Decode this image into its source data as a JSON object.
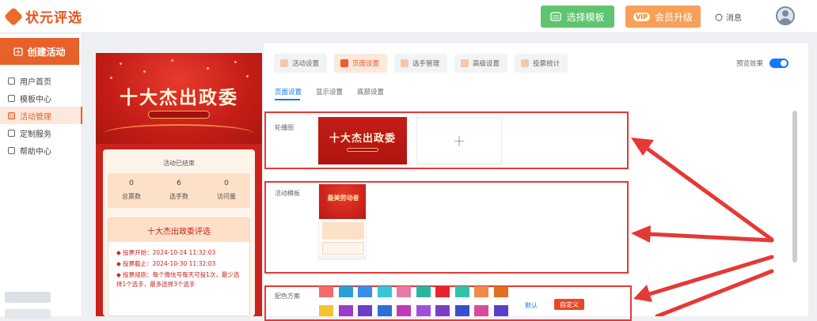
{
  "header": {
    "logo_text": "状元评选",
    "template_button": "选择模板",
    "vip_badge": "VIP",
    "vip_button": "会员升级",
    "messages": "消息"
  },
  "sidebar": {
    "create_button": "创建活动",
    "items": [
      {
        "label": "用户首页",
        "icon": "home-icon",
        "active": false
      },
      {
        "label": "模板中心",
        "icon": "folder-icon",
        "active": false
      },
      {
        "label": "活动管理",
        "icon": "list-icon",
        "active": true
      },
      {
        "label": "定制服务",
        "icon": "service-icon",
        "active": false
      },
      {
        "label": "帮助中心",
        "icon": "help-icon",
        "active": false
      }
    ]
  },
  "preview": {
    "title": "十大杰出政委",
    "status": "活动已结束",
    "stats": [
      {
        "value": "0",
        "label": "总票数"
      },
      {
        "value": "6",
        "label": "选手数"
      },
      {
        "value": "0",
        "label": "访问量"
      }
    ],
    "event_title": "十大杰出政委评选",
    "lines": [
      "投票开始：2024-10-24 11:32:03",
      "投票截止：2024-10-30 11:32:03",
      "投票规则：每个微信号每天可投1次，最少选择1个选手，最多选择3个选手"
    ]
  },
  "tabs": [
    {
      "label": "活动设置",
      "active": false
    },
    {
      "label": "页面设置",
      "active": true
    },
    {
      "label": "选手管理",
      "active": false
    },
    {
      "label": "高级设置",
      "active": false
    },
    {
      "label": "投票统计",
      "active": false
    }
  ],
  "preview_toggle_label": "预览效果",
  "subtabs": [
    {
      "label": "页面设置",
      "active": true
    },
    {
      "label": "显示设置",
      "active": false
    },
    {
      "label": "底部设置",
      "active": false
    }
  ],
  "sections": {
    "carousel_label": "轮播图",
    "carousel_thumb_title": "十大杰出政委",
    "template_label": "活动模板",
    "template_thumb_title": "最美劳动者",
    "color_label": "配色方案",
    "default_link": "默认",
    "custom_button": "自定义"
  },
  "colors": {
    "accent": "#e8602a",
    "primary_blue": "#1677ff",
    "annotation_red": "#e53935",
    "swatches_row1": [
      "#f26b6b",
      "#2a9fd6",
      "#3b8cf0",
      "#35c6d8",
      "#e87aa8",
      "#2bb5a0",
      "#e8242a",
      "#2ec4a8",
      "#f08a4b",
      "#e07020"
    ],
    "swatches_row2": [
      "#f5c230",
      "#9b3bc7",
      "#6a3cc8",
      "#2d6fd6",
      "#c13ab8",
      "#a24fd8",
      "#7a3fc0",
      "#3a50c8",
      "#d84c9c",
      "#5a3fc6"
    ]
  }
}
